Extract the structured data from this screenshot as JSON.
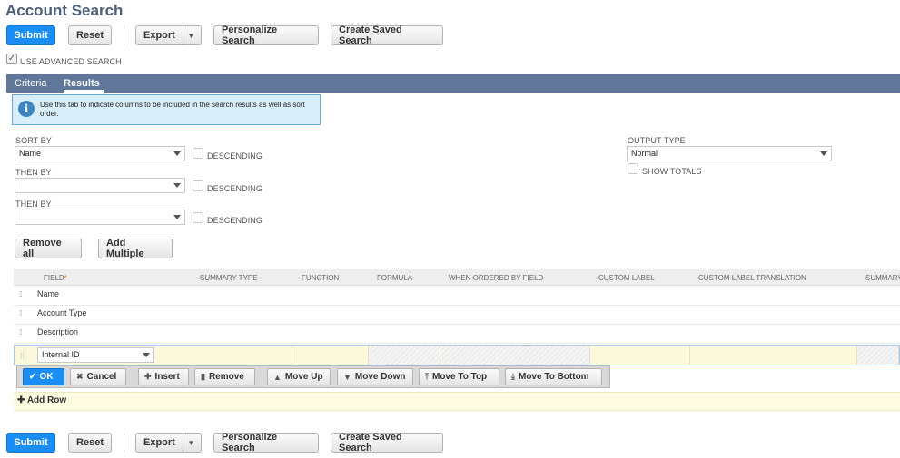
{
  "page": {
    "title": "Account Search"
  },
  "toolbar": {
    "submit": "Submit",
    "reset": "Reset",
    "export": "Export",
    "personalize": "Personalize Search",
    "create_saved": "Create Saved Search"
  },
  "advanced": {
    "label": "USE ADVANCED SEARCH",
    "checked": true
  },
  "tabs": [
    {
      "label": "Criteria"
    },
    {
      "label": "Results",
      "active": true
    }
  ],
  "info": {
    "text": "Use this tab to indicate columns to be included in the search results as well as sort order."
  },
  "sort": {
    "sort_by_label": "SORT BY",
    "sort_by_value": "Name",
    "then_by_label": "THEN BY",
    "then_by_1_value": "",
    "then_by_2_value": "",
    "descending_label": "DESCENDING"
  },
  "output": {
    "label": "OUTPUT TYPE",
    "value": "Normal",
    "show_totals": "SHOW TOTALS"
  },
  "list_buttons": {
    "remove_all": "Remove all",
    "add_multiple": "Add Multiple"
  },
  "grid": {
    "headers": [
      "FIELD",
      "SUMMARY TYPE",
      "FUNCTION",
      "FORMULA",
      "WHEN ORDERED BY FIELD",
      "CUSTOM LABEL",
      "CUSTOM LABEL TRANSLATION",
      "SUMMARY"
    ],
    "required_mark": "*",
    "rows": [
      "Name",
      "Account Type",
      "Description"
    ],
    "edit_value": "Internal ID"
  },
  "row_actions": {
    "ok": "OK",
    "cancel": "Cancel",
    "insert": "Insert",
    "remove": "Remove",
    "move_up": "Move Up",
    "move_down": "Move Down",
    "move_top": "Move To Top",
    "move_bottom": "Move To Bottom"
  },
  "add_row": "Add Row",
  "icons": [
    "info-icon",
    "checkmark-icon",
    "close-icon",
    "plus-icon",
    "trash-icon",
    "arrow-up-icon",
    "arrow-down-icon",
    "drag-handle-icon",
    "chevron-down-icon"
  ]
}
